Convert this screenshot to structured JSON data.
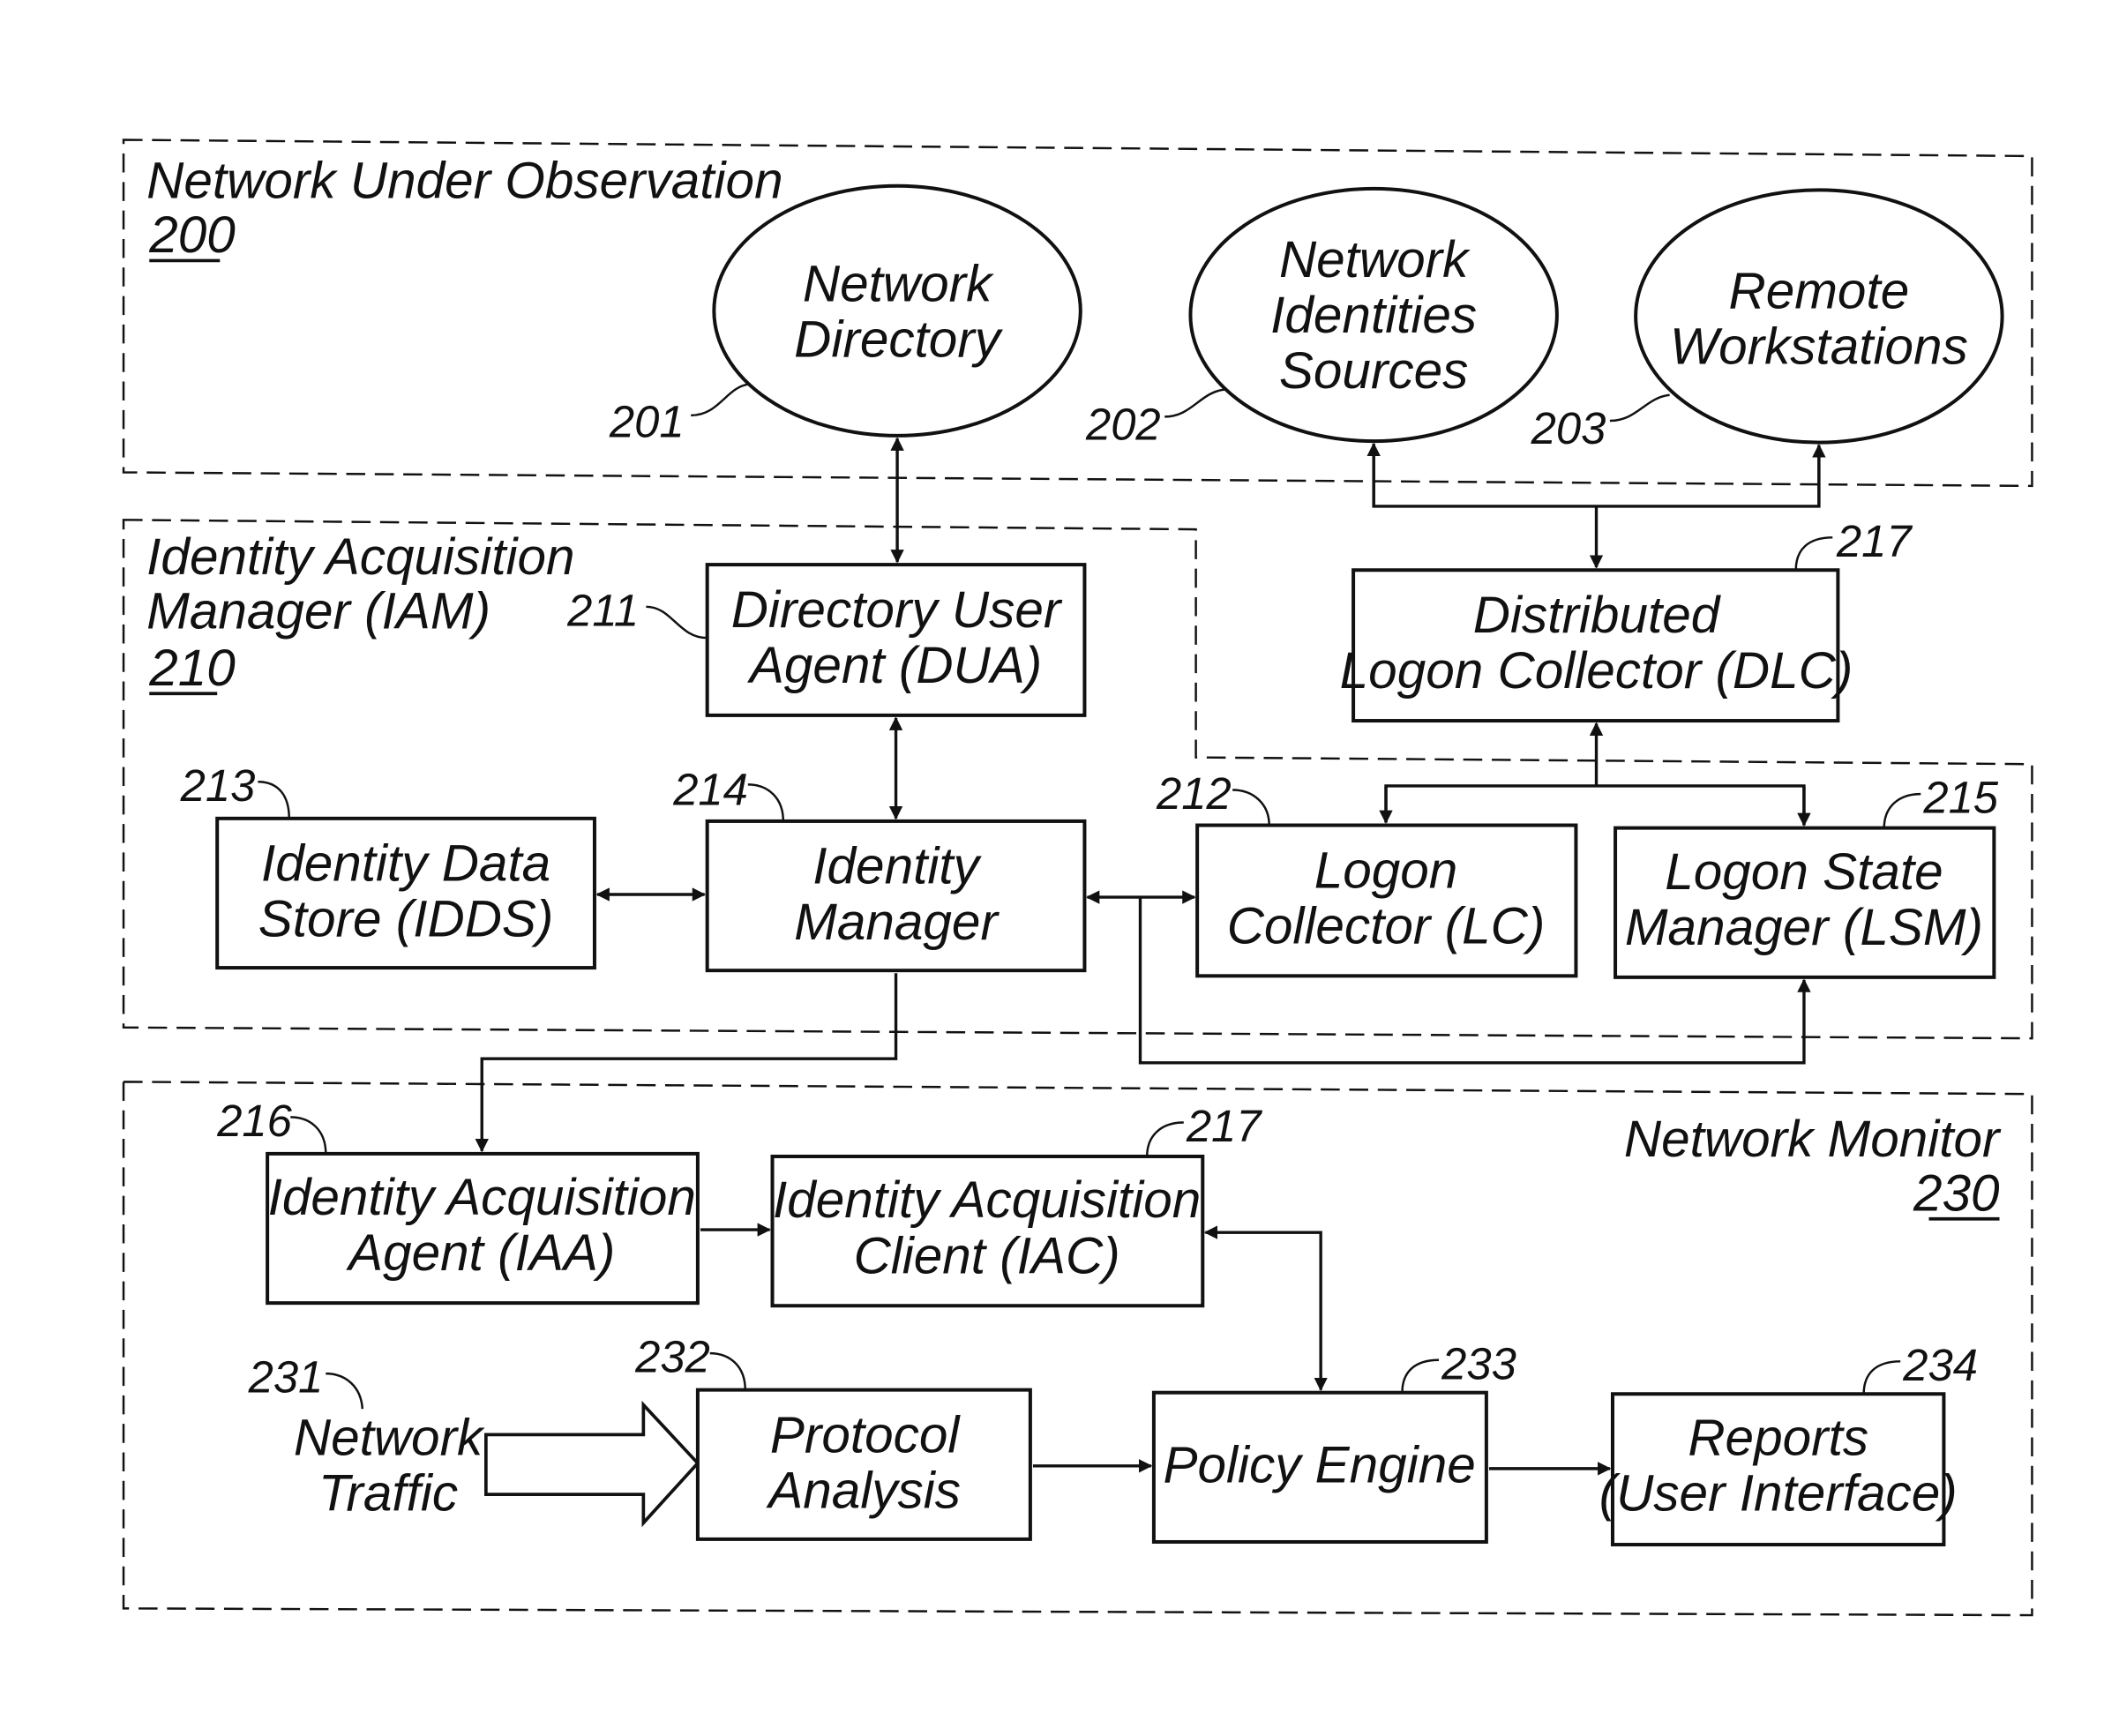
{
  "regions": {
    "network_under_observation": {
      "title": "Network Under Observation",
      "ref": "200"
    },
    "iam": {
      "title_line1": "Identity Acquisition",
      "title_line2": "Manager (IAM)",
      "ref": "210"
    },
    "network_monitor": {
      "title": "Network Monitor",
      "ref": "230"
    }
  },
  "nodes": {
    "network_directory": {
      "line1": "Network",
      "line2": "Directory",
      "ref": "201"
    },
    "network_identities_sources": {
      "line1": "Network",
      "line2": "Identities",
      "line3": "Sources",
      "ref": "202"
    },
    "remote_workstations": {
      "line1": "Remote",
      "line2": "Workstations",
      "ref": "203"
    },
    "dua": {
      "line1": "Directory User",
      "line2": "Agent (DUA)",
      "ref": "211"
    },
    "dlc": {
      "line1": "Distributed",
      "line2": "Logon Collector (DLC)",
      "ref": "217"
    },
    "idds": {
      "line1": "Identity Data",
      "line2": "Store (IDDS)",
      "ref": "213"
    },
    "identity_manager": {
      "line1": "Identity",
      "line2": "Manager",
      "ref": "214"
    },
    "logon_collector": {
      "line1": "Logon",
      "line2": "Collector (LC)",
      "ref": "212"
    },
    "lsm": {
      "line1": "Logon State",
      "line2": "Manager (LSM)",
      "ref": "215"
    },
    "iaa": {
      "line1": "Identity Acquisition",
      "line2": "Agent (IAA)",
      "ref": "216"
    },
    "iac": {
      "line1": "Identity Acquisition",
      "line2": "Client (IAC)",
      "ref": "217"
    },
    "network_traffic": {
      "line1": "Network",
      "line2": "Traffic",
      "ref": "231"
    },
    "protocol_analysis": {
      "line1": "Protocol",
      "line2": "Analysis",
      "ref": "232"
    },
    "policy_engine": {
      "line1": "Policy Engine",
      "ref": "233"
    },
    "reports": {
      "line1": "Reports",
      "line2": "(User Interface)",
      "ref": "234"
    }
  }
}
